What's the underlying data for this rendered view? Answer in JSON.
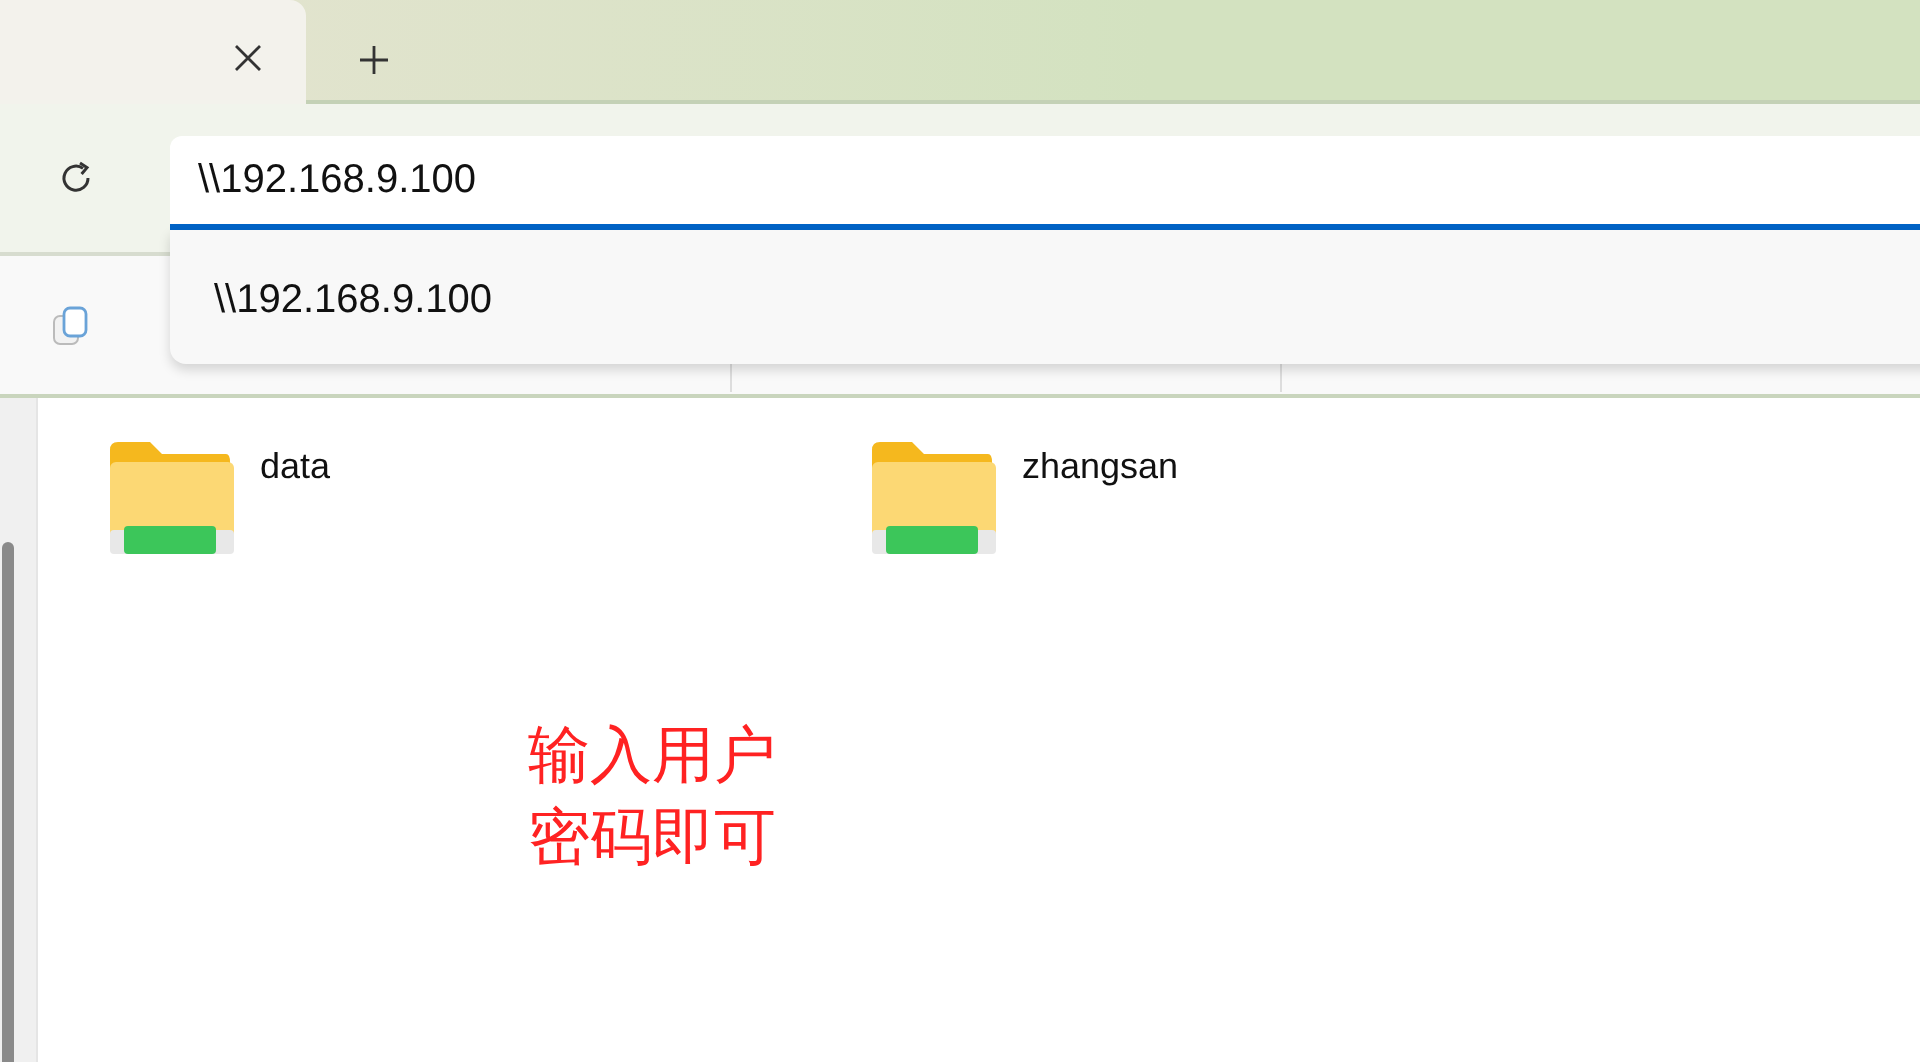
{
  "address_bar": {
    "value": "\\\\192.168.9.100"
  },
  "suggestions": [
    {
      "text": "\\\\192.168.9.100"
    }
  ],
  "folders": [
    {
      "name": "data"
    },
    {
      "name": "zhangsan"
    }
  ],
  "annotation": {
    "text": "输入用户密码即可"
  }
}
